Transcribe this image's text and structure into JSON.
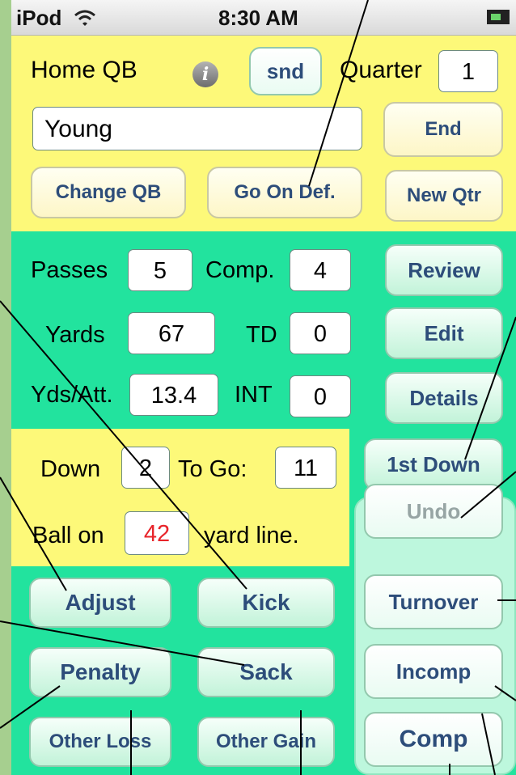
{
  "status_bar": {
    "carrier": "iPod",
    "time": "8:30 AM",
    "wifi_icon": "wifi-icon",
    "battery_icon": "battery-charging-icon"
  },
  "header": {
    "team_label": "Home QB",
    "info_icon": "info-icon",
    "snd_label": "snd",
    "quarter_label": "Quarter",
    "quarter_value": "1",
    "qb_name": "Young",
    "end_label": "End",
    "change_qb_label": "Change QB",
    "go_on_def_label": "Go On Def.",
    "new_qtr_label": "New Qtr"
  },
  "stats": {
    "passes_label": "Passes",
    "passes_value": "5",
    "comp_label": "Comp.",
    "comp_value": "4",
    "yards_label": "Yards",
    "yards_value": "67",
    "td_label": "TD",
    "td_value": "0",
    "ydsatt_label": "Yds/Att.",
    "ydsatt_value": "13.4",
    "int_label": "INT",
    "int_value": "0"
  },
  "side_buttons": {
    "review": "Review",
    "edit": "Edit",
    "details": "Details",
    "first_down": "1st Down"
  },
  "situation": {
    "down_label": "Down",
    "down_value": "2",
    "togo_label": "To Go:",
    "togo_value": "11",
    "ballon_label": "Ball on",
    "ballon_value": "42",
    "yardline_label": "yard line.",
    "ballon_color": "#e8242a"
  },
  "plays": {
    "adjust": "Adjust",
    "kick": "Kick",
    "penalty": "Penalty",
    "sack": "Sack",
    "other_loss": "Other Loss",
    "other_gain": "Other Gain"
  },
  "result_panel": {
    "undo": "Undo",
    "turnover": "Turnover",
    "incomp": "Incomp",
    "comp": "Comp"
  },
  "colors": {
    "yellow": "#fdf979",
    "green": "#22e39e",
    "button_text": "#2d4d7a",
    "frame": "#a6cf8f"
  }
}
